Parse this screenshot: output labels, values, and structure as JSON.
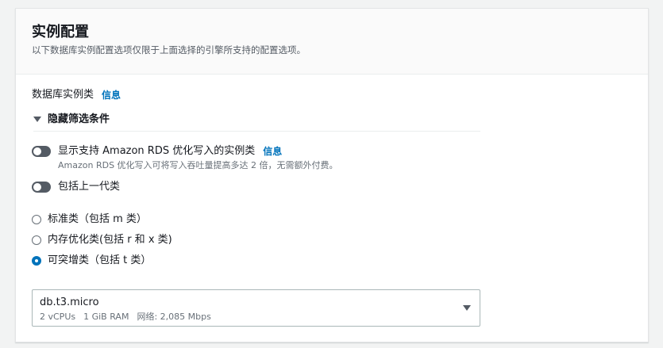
{
  "panel": {
    "title": "实例配置",
    "description": "以下数据库实例配置选项仅限于上面选择的引擎所支持的配置选项。"
  },
  "instance_class": {
    "label": "数据库实例类",
    "info": "信息"
  },
  "filters": {
    "expander_label": "隐藏筛选条件",
    "optimized_writes_toggle": {
      "label": "显示支持 Amazon RDS 优化写入的实例类",
      "info": "信息",
      "description": "Amazon RDS 优化写入可将写入吞吐量提高多达 2 倍，无需额外付费。",
      "enabled": false
    },
    "previous_gen_toggle": {
      "label": "包括上一代类",
      "enabled": false
    }
  },
  "class_options": [
    {
      "label": "标准类（包括 m 类）",
      "selected": false
    },
    {
      "label": "内存优化类(包括 r 和 x 类)",
      "selected": false
    },
    {
      "label": "可突增类（包括 t 类）",
      "selected": true
    }
  ],
  "instance_select": {
    "value": "db.t3.micro",
    "vcpus": "2 vCPUs",
    "memory": "1 GiB RAM",
    "network": "网络: 2,085 Mbps"
  },
  "colors": {
    "accent": "#0073bb",
    "toggle_off": "#545b64",
    "border": "#aab7b8"
  },
  "icons": {
    "expander": "caret-down-icon",
    "select": "caret-down-icon"
  }
}
